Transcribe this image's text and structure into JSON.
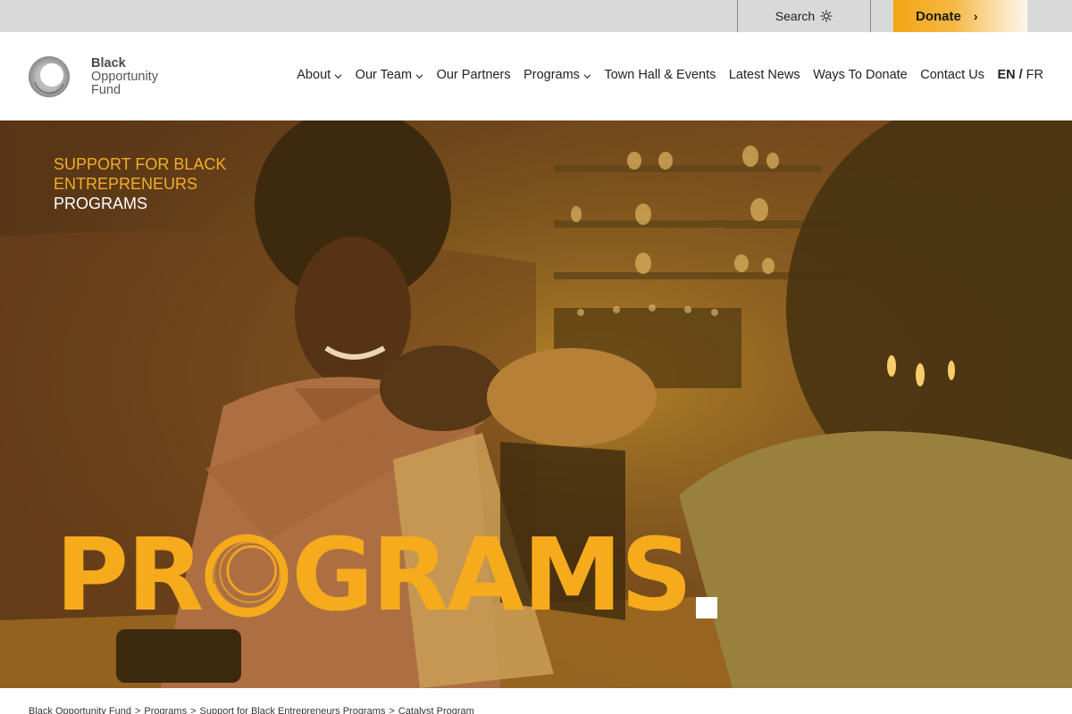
{
  "topbar": {
    "search_label": "Search",
    "search_icon": "sun-search-icon",
    "donate_label": "Donate",
    "donate_chevron": "›"
  },
  "logo": {
    "line1": "Black",
    "line2": "Opportunity",
    "line3": "Fund"
  },
  "nav": {
    "items": [
      {
        "label": "About",
        "has_dropdown": true
      },
      {
        "label": "Our Team",
        "has_dropdown": true
      },
      {
        "label": "Our Partners",
        "has_dropdown": false
      },
      {
        "label": "Programs",
        "has_dropdown": true
      },
      {
        "label": "Town Hall & Events",
        "has_dropdown": false
      },
      {
        "label": "Latest News",
        "has_dropdown": false
      },
      {
        "label": "Ways To Donate",
        "has_dropdown": false
      },
      {
        "label": "Contact Us",
        "has_dropdown": false
      }
    ],
    "lang_en": "EN",
    "lang_sep": "/",
    "lang_fr": "FR"
  },
  "hero": {
    "kicker_line1": "SUPPORT FOR BLACK",
    "kicker_line2": "ENTREPRENEURS",
    "kicker_line3": "PROGRAMS",
    "title_part1": "PR",
    "title_part2": "GRAMS",
    "accent_color": "#f6ab1c"
  },
  "breadcrumb": {
    "items": [
      "Black Opportunity Fund",
      "Programs",
      "Support for Black Entrepreneurs Programs",
      "Catalyst Program"
    ],
    "separator": ">"
  }
}
